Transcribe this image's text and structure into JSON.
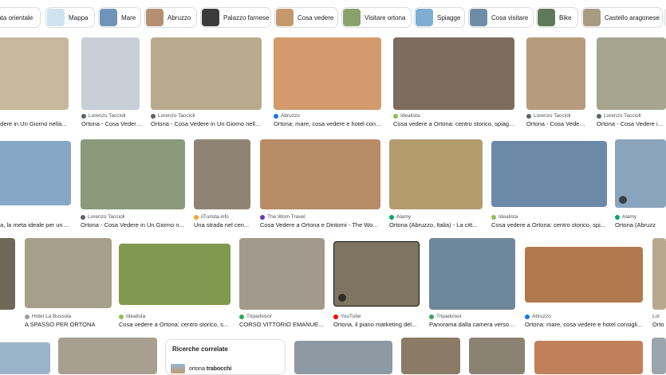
{
  "chips": [
    {
      "label": "giata orientale",
      "color": "#a8a7a0"
    },
    {
      "label": "Mappa",
      "color": "#cfe3f0"
    },
    {
      "label": "Mare",
      "color": "#6e95b8"
    },
    {
      "label": "Abruzzo",
      "color": "#b58f72"
    },
    {
      "label": "Palazzo farnese",
      "color": "#3b3b3b"
    },
    {
      "label": "Cosa vedere",
      "color": "#c49a6c"
    },
    {
      "label": "Visitare ortona",
      "color": "#8aa36c"
    },
    {
      "label": "Spiagge",
      "color": "#7eaed3"
    },
    {
      "label": "Cosa visitare",
      "color": "#6f8ca7"
    },
    {
      "label": "Bike",
      "color": "#5f7a58"
    },
    {
      "label": "Castello aragonese",
      "color": "#a79c82"
    }
  ],
  "row1": [
    {
      "source": "",
      "title": "edere in Un Giorno nella...",
      "fav": "#888",
      "img": "#c8b89e"
    },
    {
      "source": "Lorenzo Taccioli",
      "title": "Ortona - Cosa Vedere ...",
      "fav": "#5f6368",
      "img": "#c9cfd6"
    },
    {
      "source": "Lorenzo Taccioli",
      "title": "Ortona - Cosa Vedere in Un Giorno nella...",
      "fav": "#5f6368",
      "img": "#b9aa8e"
    },
    {
      "source": "Abruzzo",
      "title": "Ortona: mare, cosa vedere e hotel cons...",
      "fav": "#1a73e8",
      "img": "#d39b6d"
    },
    {
      "source": "Idealista",
      "title": "Cosa vedere a Ortona: centro storico, spiagg...",
      "fav": "#8bc34a",
      "img": "#7d6c5d"
    },
    {
      "source": "Lorenzo Taccioli",
      "title": "Ortona - Cosa Vedere ...",
      "fav": "#5f6368",
      "img": "#b69c7c"
    },
    {
      "source": "Lorenzo Taccioli",
      "title": "Ortona - Cosa Vedere in Un",
      "fav": "#5f6368",
      "img": "#a7a48f"
    }
  ],
  "row2": [
    {
      "source": "",
      "title": "na, la meta ideale per un ...",
      "fav": "#888",
      "img": "#86a8c6"
    },
    {
      "source": "Lorenzo Taccioli",
      "title": "Ortona - Cosa Vedere in Un Giorno n...",
      "fav": "#5f6368",
      "img": "#8a9a7a"
    },
    {
      "source": "ilTurista.info",
      "title": "Una strada nel cen...",
      "fav": "#f5a623",
      "img": "#8f8474"
    },
    {
      "source": "The Wom Travel",
      "title": "Cosa Vedere a Ortona e Dintorni - The Wo...",
      "fav": "#673ab7",
      "img": "#b78c67"
    },
    {
      "source": "Alamy",
      "title": "Ortona (Abruzzo, Italia) - La citt...",
      "fav": "#00a86b",
      "img": "#b49c6e"
    },
    {
      "source": "Idealista",
      "title": "Cosa vedere a Ortona: centro storico, spi...",
      "fav": "#8bc34a",
      "img": "#6c8aa8"
    },
    {
      "source": "Alamy",
      "title": "Ortona (Abruzz",
      "fav": "#00a86b",
      "img": "#8aa4bd"
    }
  ],
  "row3": [
    {
      "source": "",
      "title": "e",
      "fav": "#888",
      "img": "#6f6757"
    },
    {
      "source": "Hotel La Bussola",
      "title": "A SPASSO PER ORTONA",
      "fav": "#9e9e9e",
      "img": "#a6a08a"
    },
    {
      "source": "Idealista",
      "title": "Cosa vedere a Ortona: centro storico, s...",
      "fav": "#8bc34a",
      "img": "#7f9a4f"
    },
    {
      "source": "Tripadvisor",
      "title": "CORSO VITTORIO EMANUE...",
      "fav": "#34a853",
      "img": "#a29a8c"
    },
    {
      "source": "YouTube",
      "title": "Ortona, il piano marketing del...",
      "fav": "#ff0000",
      "img": "#7e7462"
    },
    {
      "source": "Tripadvisor",
      "title": "Panorama dalla camera verso ...",
      "fav": "#34a853",
      "img": "#6f879b"
    },
    {
      "source": "Abruzzo",
      "title": "Ortona: mare, cosa vedere e hotel consigli...",
      "fav": "#1a73e8",
      "img": "#b07a4e"
    },
    {
      "source": "Lor",
      "title": "Orto",
      "fav": "#5f6368",
      "img": "#b8a88e"
    }
  ],
  "row4": [
    {
      "img": "#9bb3c9"
    },
    {
      "img": "#a79f90"
    },
    {
      "img": "#8e9aa3"
    },
    {
      "img": "#8b7a66"
    },
    {
      "img": "#8a8373"
    },
    {
      "img": "#c0805a"
    },
    {
      "img": "#9aa6ae"
    }
  ],
  "related": {
    "heading": "Ricerche correlate",
    "item_prefix": "ortona ",
    "item_bold": "trabocchi"
  }
}
